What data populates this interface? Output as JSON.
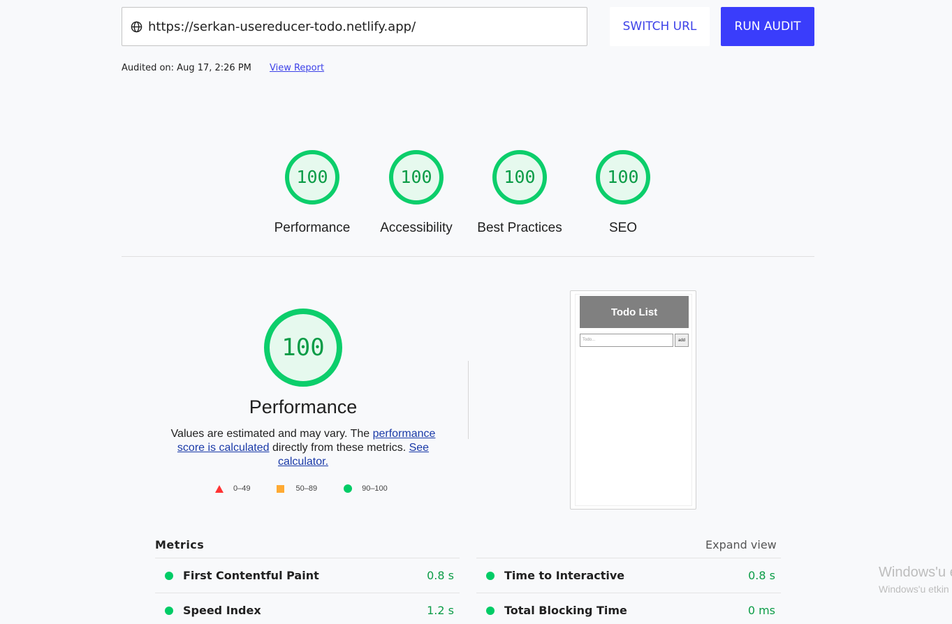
{
  "topbar": {
    "url": "https://serkan-usereducer-todo.netlify.app/",
    "switch_label": "SWITCH URL",
    "run_label": "RUN AUDIT",
    "audited_text": "Audited on: Aug 17, 2:26 PM",
    "view_report": "View Report"
  },
  "colors": {
    "accent": "#3a3dfb",
    "pass": "#0cce6b",
    "pass_text": "#0b9c47",
    "average": "#ffaa33",
    "fail": "#ff3333"
  },
  "gauges": [
    {
      "score": "100",
      "label": "Performance",
      "value": 100
    },
    {
      "score": "100",
      "label": "Accessibility",
      "value": 100
    },
    {
      "score": "100",
      "label": "Best Practices",
      "value": 100
    },
    {
      "score": "100",
      "label": "SEO",
      "value": 100
    }
  ],
  "performance": {
    "score": "100",
    "value": 100,
    "title": "Performance",
    "desc_pre": "Values are estimated and may vary. The ",
    "desc_link1": "performance score is calculated",
    "desc_mid": " directly from these metrics. ",
    "desc_link2": "See calculator.",
    "legend": {
      "fail": "0–49",
      "average": "50–89",
      "pass": "90–100"
    }
  },
  "thumbnail": {
    "header": "Todo List",
    "placeholder": "Todo...",
    "add": "add"
  },
  "metrics": {
    "title": "Metrics",
    "expand": "Expand view",
    "items": [
      {
        "name": "First Contentful Paint",
        "value": "0.8 s"
      },
      {
        "name": "Time to Interactive",
        "value": "0.8 s"
      },
      {
        "name": "Speed Index",
        "value": "1.2 s"
      },
      {
        "name": "Total Blocking Time",
        "value": "0 ms"
      }
    ]
  },
  "watermark": {
    "line1": "Windows'u e",
    "line2": "Windows'u etkin"
  }
}
